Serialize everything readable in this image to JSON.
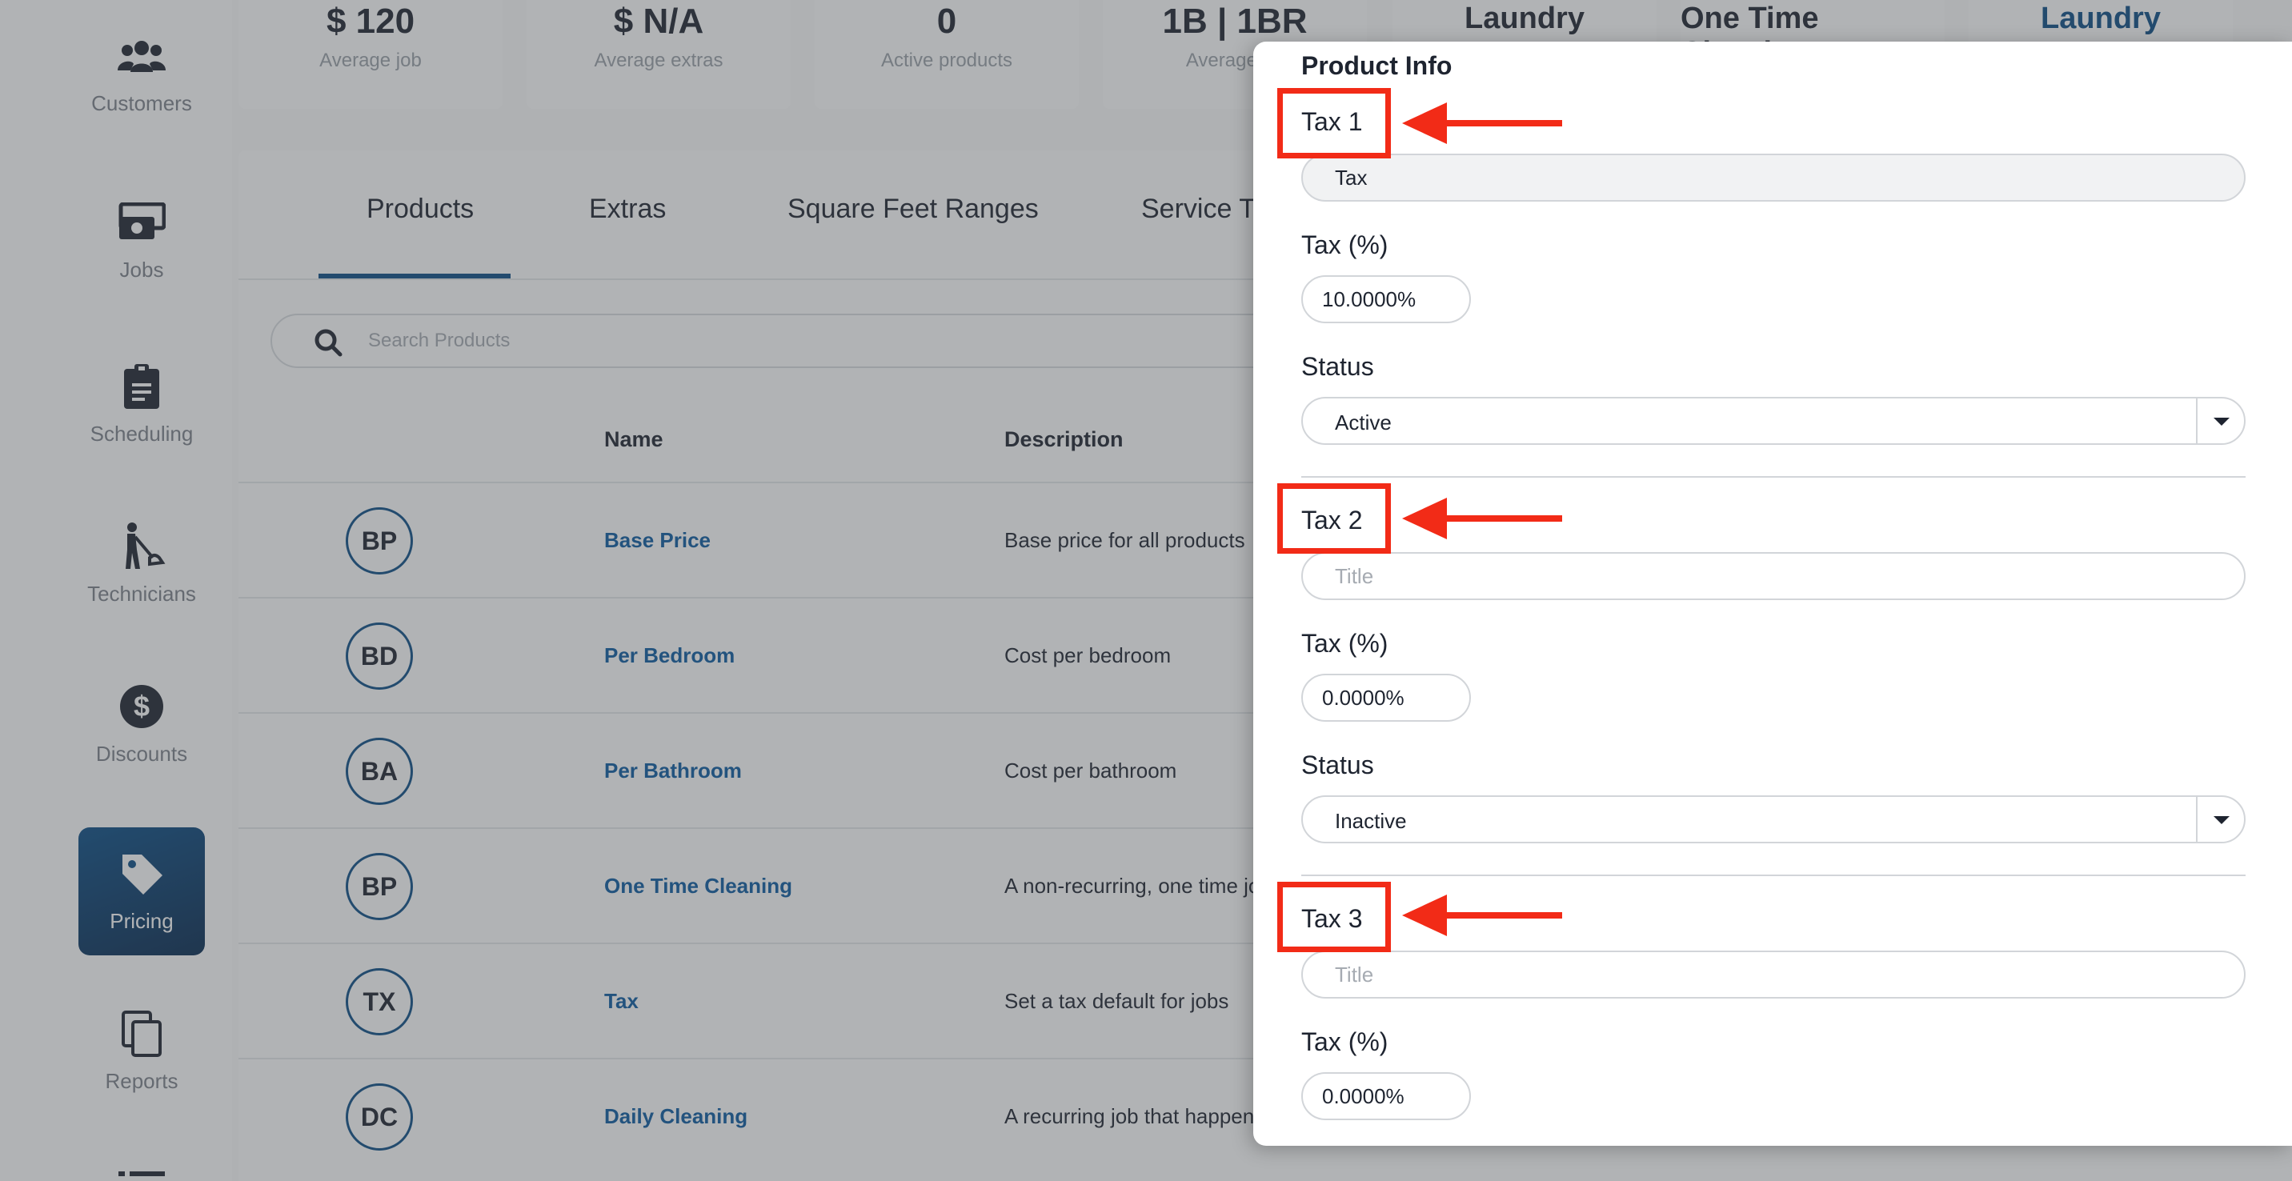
{
  "sidebar": {
    "items": [
      {
        "label": "Customers",
        "icon": "users-icon"
      },
      {
        "label": "Jobs",
        "icon": "money-stack-icon"
      },
      {
        "label": "Scheduling",
        "icon": "clipboard-icon"
      },
      {
        "label": "Technicians",
        "icon": "vacuum-person-icon"
      },
      {
        "label": "Discounts",
        "icon": "dollar-circle-icon"
      },
      {
        "label": "Pricing",
        "icon": "price-tag-icon",
        "active": true
      },
      {
        "label": "Reports",
        "icon": "copy-icon"
      }
    ]
  },
  "stats": [
    {
      "value": "$ 120",
      "label": "Average job"
    },
    {
      "value": "$ N/A",
      "label": "Average extras"
    },
    {
      "value": "0",
      "label": "Active products"
    },
    {
      "value": "1B | 1BR",
      "label": "Average be"
    }
  ],
  "top_tabs": [
    "Laundry",
    "One Time Cleaning",
    "Laundry"
  ],
  "tabs": [
    "Products",
    "Extras",
    "Square Feet Ranges",
    "Service Ty"
  ],
  "search": {
    "placeholder": "Search Products"
  },
  "table": {
    "columns": [
      "Name",
      "Description"
    ],
    "rows": [
      {
        "initials": "BP",
        "name": "Base Price",
        "description": "Base price for all products"
      },
      {
        "initials": "BD",
        "name": "Per Bedroom",
        "description": "Cost per bedroom"
      },
      {
        "initials": "BA",
        "name": "Per Bathroom",
        "description": "Cost per bathroom"
      },
      {
        "initials": "BP",
        "name": "One Time Cleaning",
        "description": "A non-recurring, one time jo"
      },
      {
        "initials": "TX",
        "name": "Tax",
        "description": "Set a tax default for jobs"
      },
      {
        "initials": "DC",
        "name": "Daily Cleaning",
        "description": "A recurring job that happens"
      }
    ]
  },
  "modal": {
    "title": "Product Info",
    "tax1": {
      "heading": "Tax 1",
      "title_value": "Tax",
      "pct_label": "Tax (%)",
      "pct_value": "10.0000%",
      "status_label": "Status",
      "status_value": "Active"
    },
    "tax2": {
      "heading": "Tax 2",
      "title_placeholder": "Title",
      "pct_label": "Tax (%)",
      "pct_value": "0.0000%",
      "status_label": "Status",
      "status_value": "Inactive"
    },
    "tax3": {
      "heading": "Tax 3",
      "title_placeholder": "Title",
      "pct_label": "Tax (%)",
      "pct_value": "0.0000%"
    }
  },
  "colors": {
    "brand": "#0b4d86",
    "annotation": "#f22b17"
  }
}
